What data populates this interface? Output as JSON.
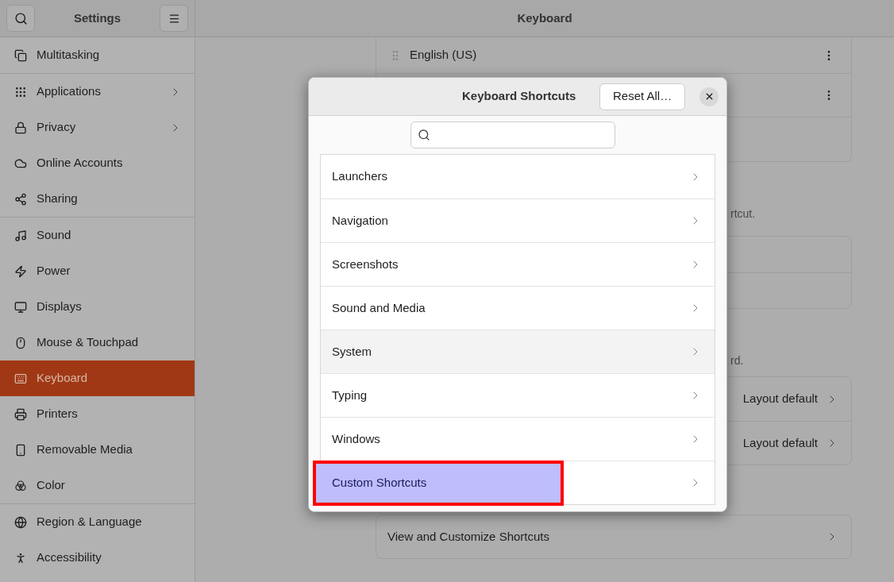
{
  "sidebar": {
    "title": "Settings",
    "sections": [
      {
        "items": [
          {
            "label": "Multitasking",
            "selected": false,
            "chevron": false
          }
        ]
      },
      {
        "items": [
          {
            "label": "Applications",
            "selected": false,
            "chevron": true
          },
          {
            "label": "Privacy",
            "selected": false,
            "chevron": true
          },
          {
            "label": "Online Accounts",
            "selected": false,
            "chevron": false
          },
          {
            "label": "Sharing",
            "selected": false,
            "chevron": false
          }
        ]
      },
      {
        "items": [
          {
            "label": "Sound",
            "selected": false,
            "chevron": false
          },
          {
            "label": "Power",
            "selected": false,
            "chevron": false
          },
          {
            "label": "Displays",
            "selected": false,
            "chevron": false
          },
          {
            "label": "Mouse & Touchpad",
            "selected": false,
            "chevron": false
          },
          {
            "label": "Keyboard",
            "selected": true,
            "chevron": false
          },
          {
            "label": "Printers",
            "selected": false,
            "chevron": false
          },
          {
            "label": "Removable Media",
            "selected": false,
            "chevron": false
          },
          {
            "label": "Color",
            "selected": false,
            "chevron": false
          }
        ]
      },
      {
        "items": [
          {
            "label": "Region & Language",
            "selected": false,
            "chevron": false
          },
          {
            "label": "Accessibility",
            "selected": false,
            "chevron": false
          }
        ]
      }
    ]
  },
  "main": {
    "title": "Keyboard",
    "input_sources": [
      {
        "label": "English (US)"
      }
    ],
    "partial_text_1": "rtcut.",
    "partial_text_2": "rd.",
    "layout_rows": [
      {
        "value": "Layout default"
      },
      {
        "value": "Layout default"
      }
    ],
    "shortcuts_row": "View and Customize Shortcuts"
  },
  "dialog": {
    "title": "Keyboard Shortcuts",
    "reset_button": "Reset All…",
    "categories": [
      {
        "label": "Launchers",
        "selected": false,
        "highlighted": false
      },
      {
        "label": "Navigation",
        "selected": false,
        "highlighted": false
      },
      {
        "label": "Screenshots",
        "selected": false,
        "highlighted": false
      },
      {
        "label": "Sound and Media",
        "selected": false,
        "highlighted": false
      },
      {
        "label": "System",
        "selected": true,
        "highlighted": false
      },
      {
        "label": "Typing",
        "selected": false,
        "highlighted": false
      },
      {
        "label": "Windows",
        "selected": false,
        "highlighted": false
      },
      {
        "label": "Custom Shortcuts",
        "selected": false,
        "highlighted": true
      }
    ]
  }
}
